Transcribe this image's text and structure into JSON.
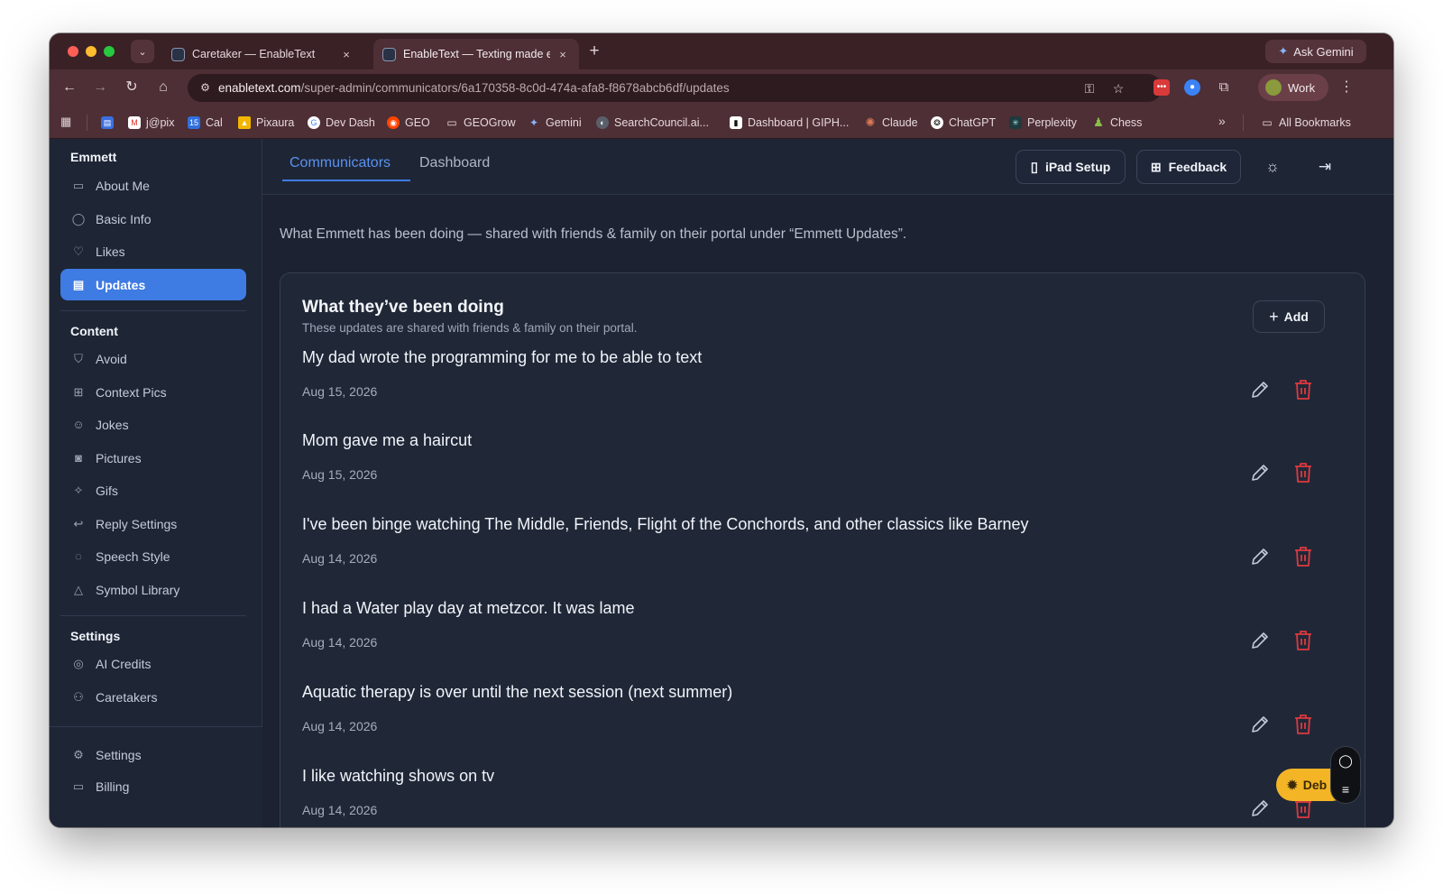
{
  "browser": {
    "tabs": [
      {
        "title": "Caretaker — EnableText",
        "close": "×"
      },
      {
        "title": "EnableText — Texting made e",
        "close": "×"
      }
    ],
    "new_tab": "+",
    "ask_gemini": "Ask Gemini",
    "url_host": "enabletext.com",
    "url_path": "/super-admin/communicators/6a170358-8c0d-474a-afa8-f8678abcb6df/updates",
    "profile": "Work",
    "bookmarks": [
      "j@pix",
      "Cal",
      "Pixaura",
      "Dev Dash",
      "GEO",
      "GEOGrow",
      "Gemini",
      "SearchCouncil.ai...",
      "Dashboard | GIPH...",
      "Claude",
      "ChatGPT",
      "Perplexity",
      "Chess",
      "All Bookmarks"
    ],
    "bookmark_more": "»"
  },
  "sidebar": {
    "user_name": "Emmett",
    "profile_items": [
      {
        "label": "About Me",
        "icon": "id-card-icon"
      },
      {
        "label": "Basic Info",
        "icon": "user-icon"
      },
      {
        "label": "Likes",
        "icon": "heart-icon"
      },
      {
        "label": "Updates",
        "icon": "newspaper-icon",
        "active": true
      }
    ],
    "content_heading": "Content",
    "content_items": [
      {
        "label": "Avoid",
        "icon": "shield-icon"
      },
      {
        "label": "Context Pics",
        "icon": "image-plus-icon"
      },
      {
        "label": "Jokes",
        "icon": "smile-icon"
      },
      {
        "label": "Pictures",
        "icon": "camera-icon"
      },
      {
        "label": "Gifs",
        "icon": "sparkles-icon"
      },
      {
        "label": "Reply Settings",
        "icon": "reply-icon"
      },
      {
        "label": "Speech Style",
        "icon": "message-circle-icon"
      },
      {
        "label": "Symbol Library",
        "icon": "shapes-icon"
      }
    ],
    "settings_heading": "Settings",
    "settings_items": [
      {
        "label": "AI Credits",
        "icon": "coins-icon"
      },
      {
        "label": "Caretakers",
        "icon": "users-icon"
      }
    ],
    "bottom_items": [
      {
        "label": "Settings",
        "icon": "gear-icon"
      },
      {
        "label": "Billing",
        "icon": "credit-card-icon"
      }
    ]
  },
  "topbar": {
    "tabs": [
      "Communicators",
      "Dashboard"
    ],
    "active_tab": "Communicators",
    "ipad_setup": "iPad Setup",
    "feedback": "Feedback"
  },
  "main": {
    "intro": "What Emmett has been doing — shared with friends & family on their portal under “Emmett Updates”.",
    "card_title": "What they’ve been doing",
    "card_subtitle": "These updates are shared with friends & family on their portal.",
    "add_label": "Add",
    "updates": [
      {
        "text": "My dad wrote the programming for me to be able to text",
        "date": "Aug 15, 2026"
      },
      {
        "text": "Mom gave me a haircut",
        "date": "Aug 15, 2026"
      },
      {
        "text": "I've been binge watching The Middle, Friends, Flight of the Conchords, and other classics like Barney",
        "date": "Aug 14, 2026"
      },
      {
        "text": "I had a Water play day at metzcor. It was lame",
        "date": "Aug 14, 2026"
      },
      {
        "text": "Aquatic therapy is over until the next session (next summer)",
        "date": "Aug 14, 2026"
      },
      {
        "text": "I like watching shows on tv",
        "date": "Aug 14, 2026"
      }
    ]
  },
  "debug": {
    "label": "Deb"
  },
  "colors": {
    "accent": "#3e7be3",
    "background": "#1c2231",
    "danger": "#e0383e",
    "browser_frame": "#4d2f35",
    "debug_pill": "#f3b526"
  }
}
